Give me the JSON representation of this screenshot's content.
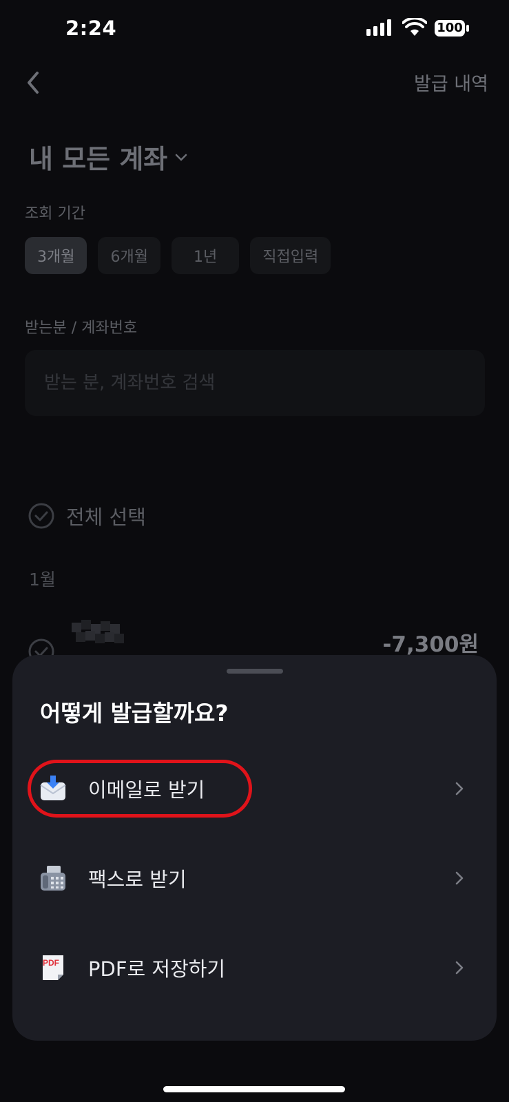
{
  "status_bar": {
    "time": "2:24",
    "battery": "100"
  },
  "header": {
    "history_label": "발급 내역"
  },
  "account": {
    "title": "내 모든 계좌"
  },
  "period": {
    "label": "조회 기간",
    "chips": [
      "3개월",
      "6개월",
      "1년",
      "직접입력"
    ],
    "selected": "3개월"
  },
  "recipient": {
    "label": "받는분 / 계좌번호",
    "placeholder": "받는 분, 계좌번호 검색"
  },
  "list": {
    "select_all": "전체 선택",
    "month": "1월",
    "transaction_amount": "-7,300원"
  },
  "sheet": {
    "title": "어떻게 발급할까요?",
    "options": [
      {
        "label": "이메일로 받기",
        "icon": "email-icon"
      },
      {
        "label": "팩스로 받기",
        "icon": "fax-icon"
      },
      {
        "label": "PDF로 저장하기",
        "icon": "pdf-icon"
      }
    ],
    "pdf_icon_text": "PDF",
    "highlight_color": "#e0131a"
  },
  "colors": {
    "background": "#0b0b0e",
    "sheet": "#1c1d24"
  }
}
